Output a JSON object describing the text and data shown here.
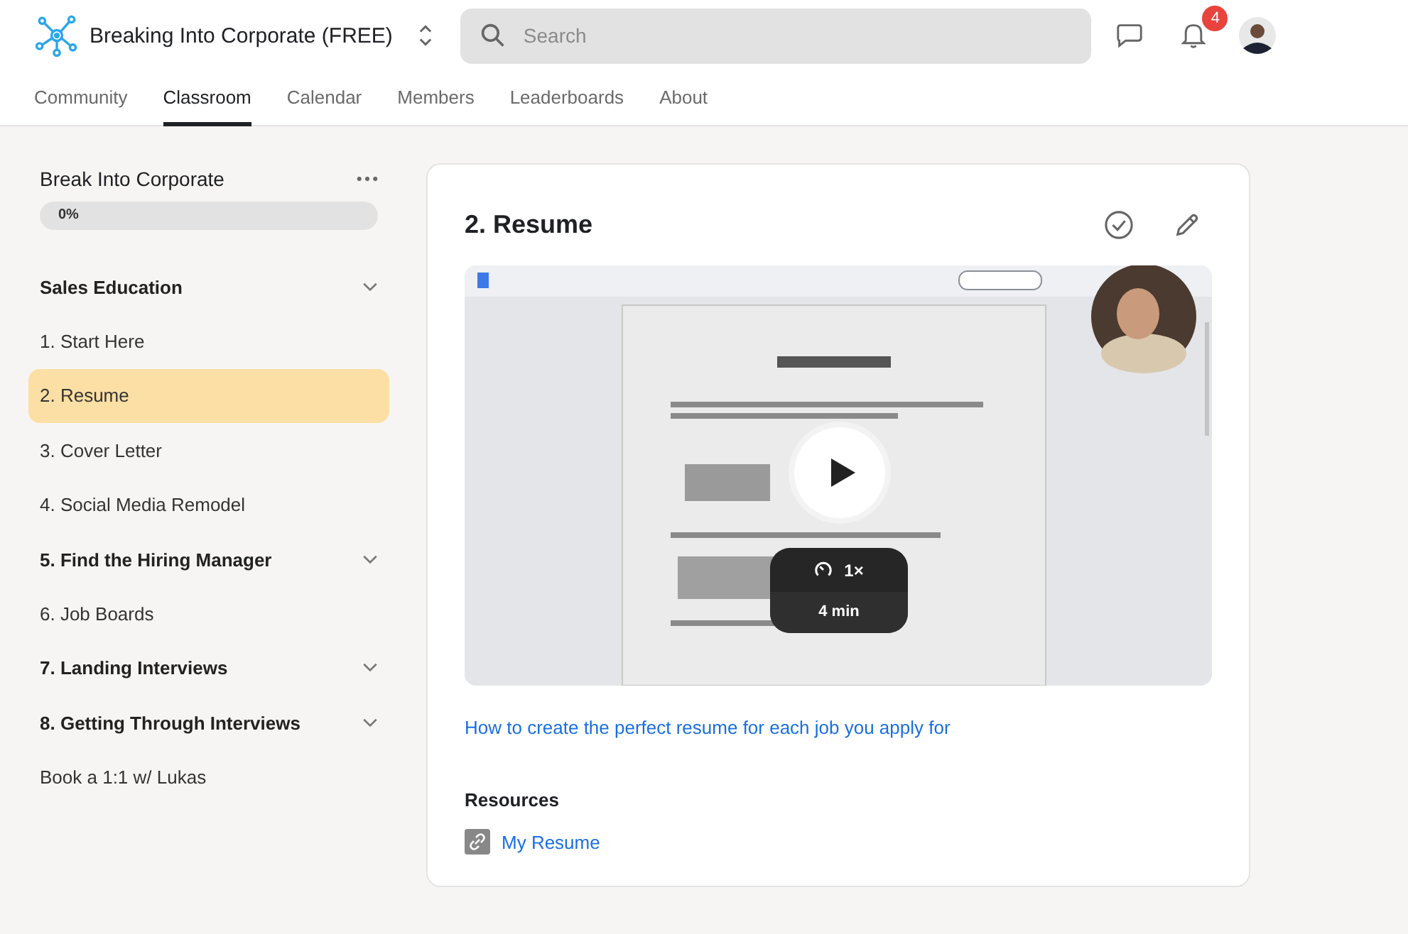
{
  "header": {
    "group_name": "Breaking Into Corporate (FREE)",
    "search": {
      "placeholder": "Search"
    },
    "notification_count": "4"
  },
  "tabs": [
    {
      "label": "Community",
      "selected": false
    },
    {
      "label": "Classroom",
      "selected": true
    },
    {
      "label": "Calendar",
      "selected": false
    },
    {
      "label": "Members",
      "selected": false
    },
    {
      "label": "Leaderboards",
      "selected": false
    },
    {
      "label": "About",
      "selected": false
    }
  ],
  "course": {
    "title": "Break Into Corporate",
    "progress": {
      "level": 0,
      "label": "0%"
    },
    "items": [
      {
        "kind": "section",
        "label": "Sales Education",
        "selected": false
      },
      {
        "kind": "lesson",
        "label": "1. Start Here",
        "selected": false
      },
      {
        "kind": "lesson",
        "label": "2. Resume",
        "selected": true
      },
      {
        "kind": "lesson",
        "label": "3. Cover Letter",
        "selected": false
      },
      {
        "kind": "lesson",
        "label": "4. Social Media Remodel",
        "selected": false
      },
      {
        "kind": "section",
        "label": "5. Find the Hiring Manager",
        "selected": false
      },
      {
        "kind": "lesson",
        "label": "6. Job Boards",
        "selected": false
      },
      {
        "kind": "section",
        "label": "7. Landing Interviews",
        "selected": false
      },
      {
        "kind": "section",
        "label": "8. Getting Through Interviews",
        "selected": false
      },
      {
        "kind": "lesson",
        "label": "Book a 1:1 w/ Lukas",
        "selected": false
      }
    ]
  },
  "lesson": {
    "title": "2. Resume",
    "video": {
      "speed": "1×",
      "duration": "4 min"
    },
    "description_link": "How to create the perfect resume for each job you apply for",
    "resources_heading": "Resources",
    "resources": [
      {
        "label": "My Resume"
      }
    ]
  }
}
